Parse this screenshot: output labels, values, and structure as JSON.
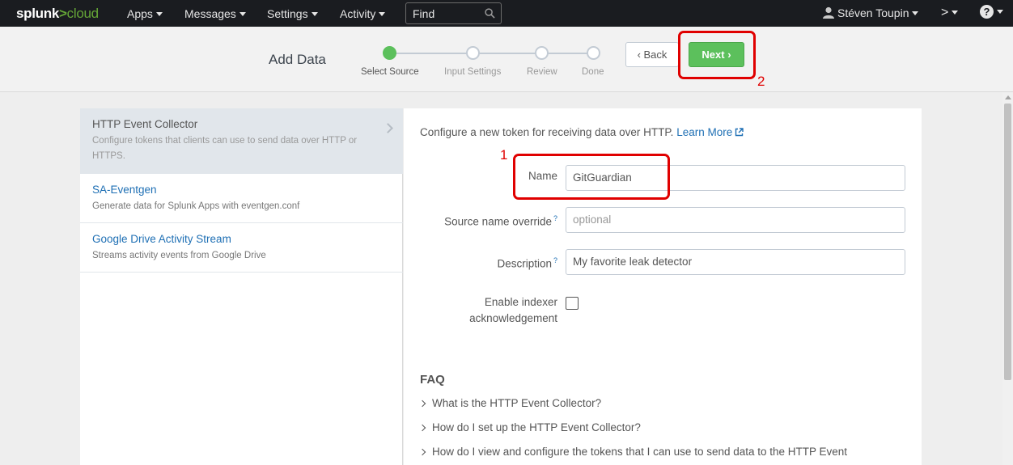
{
  "nav": {
    "logo_main": "splunk",
    "logo_gt": ">",
    "logo_sub": "cloud",
    "apps": "Apps",
    "messages": "Messages",
    "settings": "Settings",
    "activity": "Activity",
    "find_placeholder": "Find",
    "user": "Stéven Toupin",
    "prompt": ">",
    "help": "?"
  },
  "wizard": {
    "title": "Add Data",
    "steps": [
      "Select Source",
      "Input Settings",
      "Review",
      "Done"
    ],
    "current_step": 1,
    "back_label": "Back",
    "next_label": "Next"
  },
  "annotations": {
    "name_marker": "1",
    "next_marker": "2",
    "color": "#e00000"
  },
  "sources": [
    {
      "name": "HTTP Event Collector",
      "desc": "Configure tokens that clients can use to send data over HTTP or HTTPS.",
      "selected": true
    },
    {
      "name": "SA-Eventgen",
      "desc": "Generate data for Splunk Apps with eventgen.conf",
      "selected": false
    },
    {
      "name": "Google Drive Activity Stream",
      "desc": "Streams activity events from Google Drive",
      "selected": false
    }
  ],
  "form": {
    "intro": "Configure a new token for receiving data over HTTP.",
    "learn_more": "Learn More",
    "name_label": "Name",
    "name_value": "GitGuardian",
    "source_override_label": "Source name override",
    "source_override_placeholder": "optional",
    "description_label": "Description",
    "description_value": "My favorite leak detector",
    "indexer_ack_label_line1": "Enable indexer",
    "indexer_ack_label_line2": "acknowledgement",
    "indexer_ack_checked": false,
    "help_marker": "?"
  },
  "faq": {
    "title": "FAQ",
    "items": [
      "What is the HTTP Event Collector?",
      "How do I set up the HTTP Event Collector?",
      "How do I view and configure the tokens that I can use to send data to the HTTP Event"
    ]
  },
  "colors": {
    "accent_green": "#5cc05c",
    "link_blue": "#1e6fb4",
    "topbar_bg": "#1a1c20"
  }
}
